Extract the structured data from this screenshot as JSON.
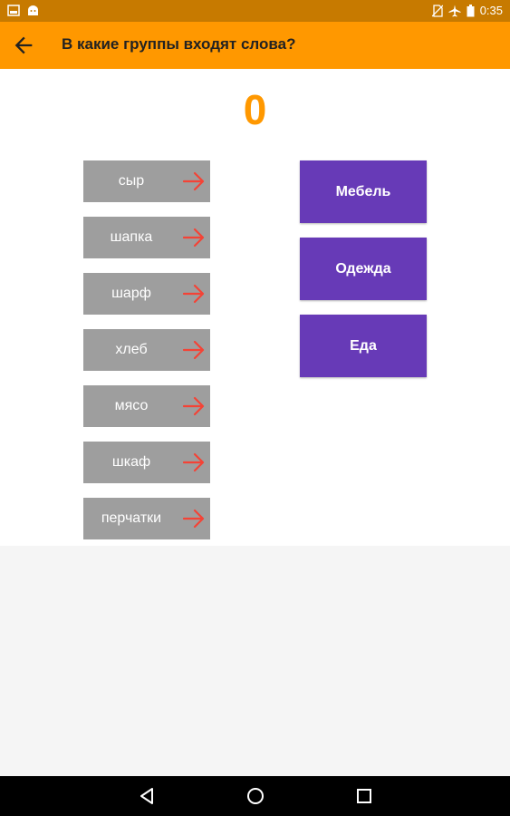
{
  "status_bar": {
    "time": "0:35",
    "icons": [
      "screenshot-icon",
      "android-icon",
      "no-sim-icon",
      "airplane-mode-icon",
      "battery-icon"
    ]
  },
  "toolbar": {
    "back_icon": "arrow-back-icon",
    "title": "В какие группы входят слова?"
  },
  "score": "0",
  "words": [
    "сыр",
    "шапка",
    "шарф",
    "хлеб",
    "мясо",
    "шкаф",
    "перчатки"
  ],
  "categories": [
    "Мебель",
    "Одежда",
    "Еда"
  ],
  "nav_bar": {
    "icons": [
      "back-triangle-icon",
      "home-circle-icon",
      "recents-square-icon"
    ]
  },
  "colors": {
    "status_bar": "#c77a00",
    "toolbar": "#ff9800",
    "score": "#ff9800",
    "word_tile": "#9e9e9e",
    "word_arrow": "#f44336",
    "category": "#673ab7"
  }
}
